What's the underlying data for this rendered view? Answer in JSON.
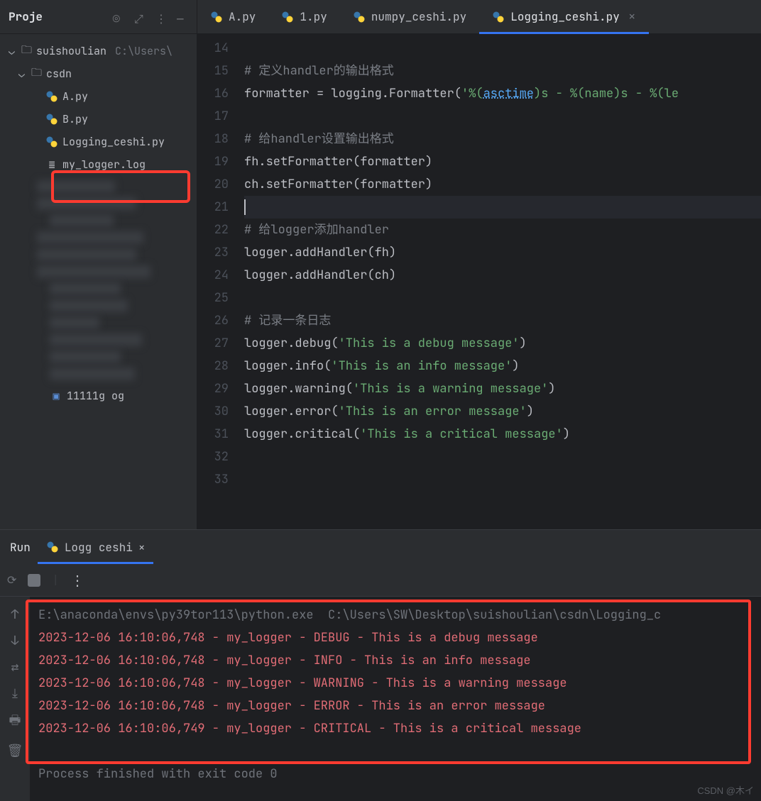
{
  "sidebar": {
    "title": "Proje",
    "root": {
      "name": "suishoulian",
      "path": "C:\\Users\\"
    },
    "folder": "csdn",
    "files": [
      "A.py",
      "B.py",
      "Logging_ceshi.py",
      "my_logger.log"
    ],
    "extra_file": "11111g      og"
  },
  "tabs": [
    {
      "label": "A.py",
      "active": false
    },
    {
      "label": "1.py",
      "active": false
    },
    {
      "label": "numpy_ceshi.py",
      "active": false
    },
    {
      "label": "Logging_ceshi.py",
      "active": true
    }
  ],
  "code": {
    "start": 14,
    "lines": [
      {
        "n": 14,
        "raw": ""
      },
      {
        "n": 15,
        "comment": "# 定义handler的输出格式"
      },
      {
        "n": 16,
        "tokens": [
          [
            "ident",
            "formatter = logging.Formatter("
          ],
          [
            "str",
            "'%("
          ],
          [
            "link",
            "asctime"
          ],
          [
            "str",
            ")s - %(name)s - %(le"
          ]
        ]
      },
      {
        "n": 17,
        "raw": ""
      },
      {
        "n": 18,
        "comment": "# 给handler设置输出格式"
      },
      {
        "n": 19,
        "tokens": [
          [
            "ident",
            "fh.setFormatter(formatter)"
          ]
        ]
      },
      {
        "n": 20,
        "tokens": [
          [
            "ident",
            "ch.setFormatter(formatter)"
          ]
        ]
      },
      {
        "n": 21,
        "current": true,
        "raw": ""
      },
      {
        "n": 22,
        "comment": "# 给logger添加handler"
      },
      {
        "n": 23,
        "tokens": [
          [
            "ident",
            "logger.addHandler(fh)"
          ]
        ]
      },
      {
        "n": 24,
        "tokens": [
          [
            "ident",
            "logger.addHandler(ch)"
          ]
        ]
      },
      {
        "n": 25,
        "raw": ""
      },
      {
        "n": 26,
        "comment": "# 记录一条日志"
      },
      {
        "n": 27,
        "tokens": [
          [
            "ident",
            "logger.debug("
          ],
          [
            "str",
            "'This is a debug message'"
          ],
          [
            "ident",
            ")"
          ]
        ]
      },
      {
        "n": 28,
        "tokens": [
          [
            "ident",
            "logger.info("
          ],
          [
            "str",
            "'This is an info message'"
          ],
          [
            "ident",
            ")"
          ]
        ]
      },
      {
        "n": 29,
        "tokens": [
          [
            "ident",
            "logger.warning("
          ],
          [
            "str",
            "'This is a warning message'"
          ],
          [
            "ident",
            ")"
          ]
        ]
      },
      {
        "n": 30,
        "tokens": [
          [
            "ident",
            "logger.error("
          ],
          [
            "str",
            "'This is an error message'"
          ],
          [
            "ident",
            ")"
          ]
        ]
      },
      {
        "n": 31,
        "tokens": [
          [
            "ident",
            "logger.critical("
          ],
          [
            "str",
            "'This is a critical message'"
          ],
          [
            "ident",
            ")"
          ]
        ]
      },
      {
        "n": 32,
        "raw": ""
      },
      {
        "n": 33,
        "raw": ""
      }
    ]
  },
  "run": {
    "label": "Run",
    "tab": "Logg    ceshi",
    "lines": [
      {
        "cls": "dim",
        "text": "E:\\anaconda\\envs\\py39tor113\\python.exe  C:\\Users\\SW\\Desktop\\suishoulian\\csdn\\Logging_c"
      },
      {
        "cls": "err",
        "text": "2023-12-06 16:10:06,748 - my_logger - DEBUG - This is a debug message"
      },
      {
        "cls": "err",
        "text": "2023-12-06 16:10:06,748 - my_logger - INFO - This is an info message"
      },
      {
        "cls": "err",
        "text": "2023-12-06 16:10:06,748 - my_logger - WARNING - This is a warning message"
      },
      {
        "cls": "err",
        "text": "2023-12-06 16:10:06,748 - my_logger - ERROR - This is an error message"
      },
      {
        "cls": "err",
        "text": "2023-12-06 16:10:06,749 - my_logger - CRITICAL - This is a critical message"
      },
      {
        "cls": "",
        "text": ""
      },
      {
        "cls": "dim",
        "text": "Process finished with exit code 0"
      }
    ]
  },
  "watermark": "CSDN @木イ"
}
